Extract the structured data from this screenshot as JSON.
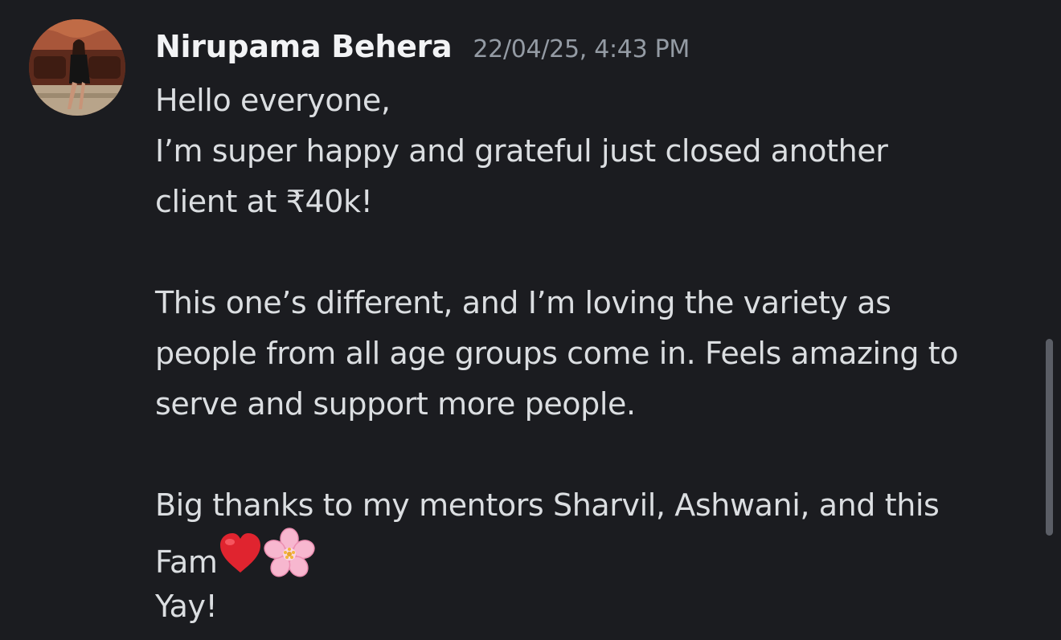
{
  "message": {
    "author": "Nirupama Behera",
    "timestamp": "22/04/25, 4:43 PM",
    "lines": {
      "l1": "Hello everyone,",
      "l2": "I’m super happy and grateful just closed another",
      "l3": "client at ₹40k!",
      "l4": "This one’s different, and I’m loving the variety as",
      "l5": "people from all age groups come in. Feels amazing to",
      "l6": "serve and support more people.",
      "l7": "Big thanks to my mentors Sharvil, Ashwani, and this",
      "l8": "Fam",
      "l9": "Yay!"
    },
    "emojis": [
      "red-heart",
      "cherry-blossom"
    ]
  },
  "colors": {
    "background": "#1b1c20",
    "author": "#f2f3f5",
    "timestamp": "#949ba4",
    "text": "#dbdee1",
    "scrollbar": "#5b5e66",
    "heart": "#e0242f",
    "blossom": "#f7b7cf"
  }
}
